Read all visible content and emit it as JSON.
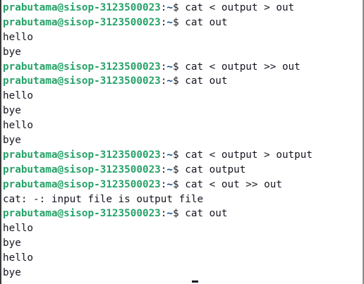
{
  "terminal": {
    "prompt_user": "prabutama@sisop-3123500023",
    "prompt_path": "~",
    "colors": {
      "background": "#ffffff",
      "foreground": "#171421",
      "prompt_user": "#26a269",
      "prompt_path": "#12488b"
    },
    "lines": [
      {
        "type": "prompt",
        "cmd": "cat < output > out"
      },
      {
        "type": "prompt",
        "cmd": "cat out"
      },
      {
        "type": "output",
        "text": "hello"
      },
      {
        "type": "output",
        "text": "bye"
      },
      {
        "type": "prompt",
        "cmd": "cat < output >> out"
      },
      {
        "type": "prompt",
        "cmd": "cat out"
      },
      {
        "type": "output",
        "text": "hello"
      },
      {
        "type": "output",
        "text": "bye"
      },
      {
        "type": "output",
        "text": "hello"
      },
      {
        "type": "output",
        "text": "bye"
      },
      {
        "type": "prompt",
        "cmd": "cat < output > output"
      },
      {
        "type": "prompt",
        "cmd": "cat output"
      },
      {
        "type": "prompt",
        "cmd": "cat < out >> out"
      },
      {
        "type": "output",
        "text": "cat: -: input file is output file"
      },
      {
        "type": "prompt",
        "cmd": "cat out"
      },
      {
        "type": "output",
        "text": "hello"
      },
      {
        "type": "output",
        "text": "bye"
      },
      {
        "type": "output",
        "text": "hello"
      },
      {
        "type": "output",
        "text": "bye"
      }
    ]
  }
}
